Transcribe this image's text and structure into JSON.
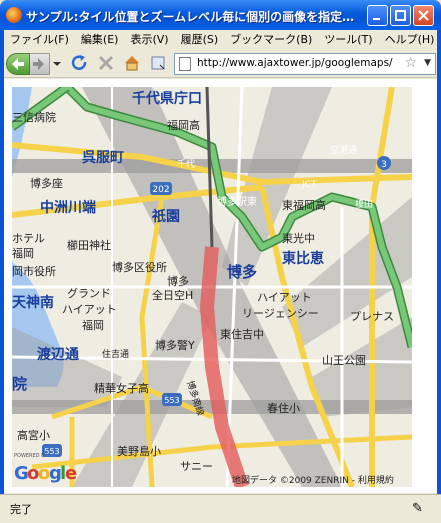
{
  "window": {
    "title": "サンプル:タイル位置とズームレベル毎に個別の画像を指定…"
  },
  "menu": {
    "items": [
      "ファイル(F)",
      "編集(E)",
      "表示(V)",
      "履歴(S)",
      "ブックマーク(B)",
      "ツール(T)",
      "ヘルプ(H)"
    ]
  },
  "toolbar": {
    "url": "http://www.ajaxtower.jp/googlemaps/",
    "back_icon": "back-arrow-icon",
    "forward_icon": "forward-arrow-icon",
    "reload_icon": "reload-icon",
    "stop_icon": "stop-icon",
    "home_icon": "home-icon"
  },
  "map": {
    "labels": {
      "kenchomae": "千代県庁口",
      "sanshin": "三信病院",
      "fukuokako": "福岡高",
      "gofukumachi": "呉服町",
      "chiyo": "千代",
      "kukodori": "空港通",
      "hakataza": "博多座",
      "nakasu": "中洲川端",
      "gion": "祇園",
      "hakataeki": "博多駅東",
      "higashifukuoka": "東福岡高",
      "jct": "JCT",
      "enokida": "榎田",
      "hotel": "ホテル",
      "fukuoka": "福岡",
      "kushida": "櫛田神社",
      "shiyakusho": "岡市役所",
      "hakataku": "博多区役所",
      "hakata": "博多",
      "higashikoenaka": "東光中",
      "higashihie": "東比恵",
      "grand": "グランド",
      "hyatt": "ハイアット",
      "fukuoka2": "福岡",
      "zennikku": "全日空H",
      "hakatako": "博多",
      "tenjin": "天神南",
      "hyattreg": "ハイアット",
      "regency": "リージェンシー",
      "purenasu": "プレナス",
      "higashiyoshizuka": "東住吉中",
      "watanabe": "渡辺通",
      "hakatasho": "博多警Y",
      "sanno": "山王公園",
      "seika": "精華女子高",
      "sumiyoshi": "住吉通",
      "haruyoshi": "春住小",
      "kashii": "院",
      "takamiya": "高宮小",
      "minoshima": "美野島小",
      "sanny": "サニー",
      "copyright": "地図データ ©2009 ZENRIN - 利用規約",
      "road202": "202",
      "road3": "3",
      "road553a": "553",
      "road553b": "553",
      "hakataminami": "博多南線"
    }
  },
  "status": {
    "text": "完了"
  }
}
